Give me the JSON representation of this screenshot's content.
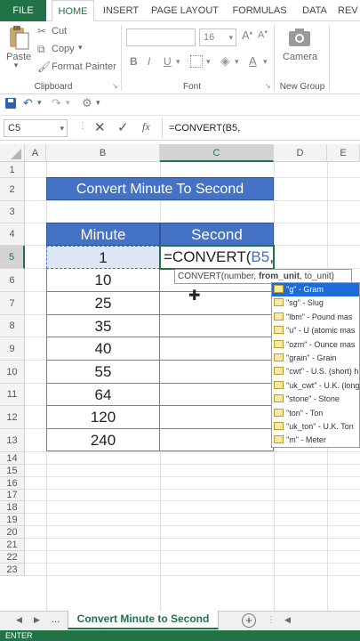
{
  "ribbon": {
    "tabs": [
      "FILE",
      "HOME",
      "INSERT",
      "PAGE LAYOUT",
      "FORMULAS",
      "DATA",
      "REV"
    ],
    "paste_label": "Paste",
    "cut_label": "Cut",
    "copy_label": "Copy",
    "format_painter_label": "Format Painter",
    "clipboard_label": "Clipboard",
    "font_size": "16",
    "font_label": "Font",
    "camera_label": "Camera",
    "new_group_label": "New Group"
  },
  "formula_bar": {
    "name_box": "C5",
    "fx_label": "fx",
    "formula": "=CONVERT(B5,"
  },
  "columns": [
    "A",
    "B",
    "C",
    "D",
    "E"
  ],
  "rows": [
    "1",
    "2",
    "3",
    "4",
    "5",
    "6",
    "7",
    "8",
    "9",
    "10",
    "11",
    "12",
    "13",
    "14",
    "15",
    "16",
    "17",
    "18",
    "19",
    "20",
    "21",
    "22",
    "23"
  ],
  "sheet": {
    "title": "Convert Minute To Second",
    "header_minute": "Minute",
    "header_second": "Second",
    "minutes": [
      "1",
      "10",
      "25",
      "35",
      "40",
      "55",
      "64",
      "120",
      "240"
    ],
    "editing_formula_prefix": "=CONVERT(",
    "editing_formula_ref": "B5",
    "editing_formula_suffix": ","
  },
  "autocomplete": {
    "tooltip_start": "CONVERT(number, ",
    "tooltip_bold": "from_unit",
    "tooltip_end": ", to_unit)",
    "items": [
      "\"g\" - Gram",
      "\"sg\" - Slug",
      "\"lbm\" - Pound mas",
      "\"u\" - U (atomic mas",
      "\"ozm\" - Ounce mas",
      "\"grain\" - Grain",
      "\"cwt\" - U.S. (short) h",
      "\"uk_cwt\" - U.K. (long",
      "\"stone\" - Stone",
      "\"ton\" - Ton",
      "\"uk_ton\" - U.K. Ton",
      "\"m\" - Meter"
    ]
  },
  "sheet_tabs": {
    "ellipsis": "...",
    "active": "Convert Minute to Second",
    "add": "+"
  },
  "status": "ENTER",
  "colors": {
    "excel_green": "#217346",
    "title_fill": "#4472c4",
    "header_fill": "#4472c4",
    "selection": "#1e6cd9"
  }
}
